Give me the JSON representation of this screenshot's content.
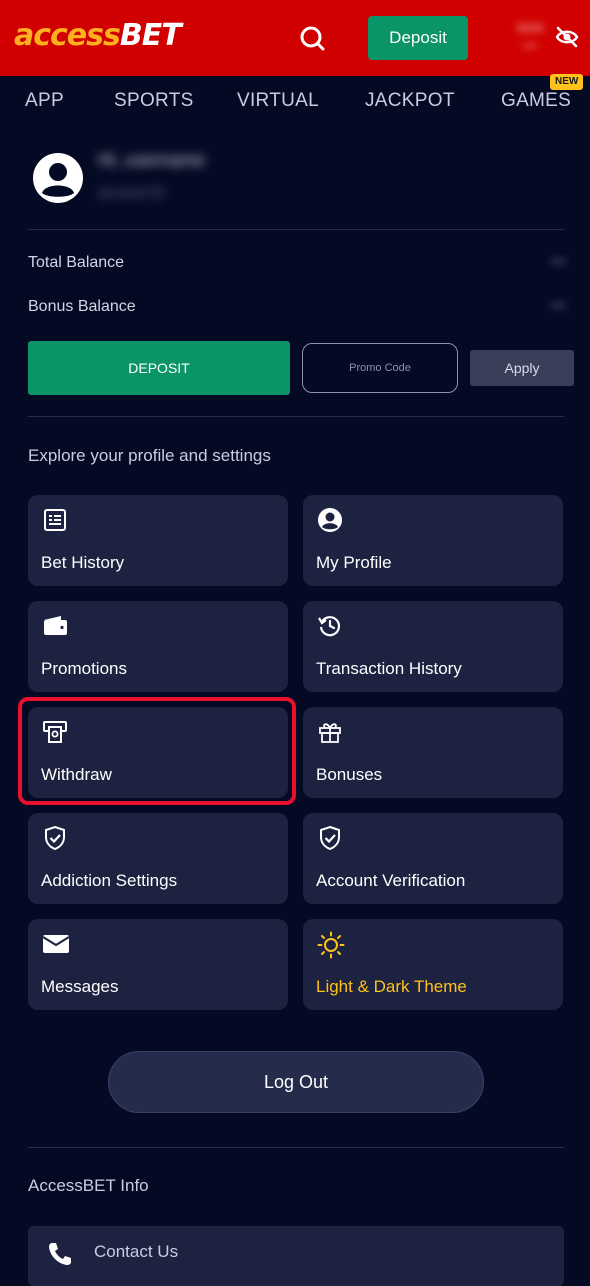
{
  "header": {
    "logo_part1": "access",
    "logo_part2": "BET",
    "deposit_label": "Deposit",
    "balance_line1": "NGN",
    "balance_line2": "***"
  },
  "nav": {
    "items": [
      "APP",
      "SPORTS",
      "VIRTUAL",
      "JACKPOT",
      "GAMES"
    ],
    "new_badge": "NEW"
  },
  "profile": {
    "greeting": "Hi, username",
    "account_line": "account ID"
  },
  "balances": {
    "total_label": "Total Balance",
    "total_value": "***",
    "bonus_label": "Bonus Balance",
    "bonus_value": "***"
  },
  "actions": {
    "deposit_label": "DEPOSIT",
    "promo_placeholder": "Promo Code",
    "apply_label": "Apply"
  },
  "settings": {
    "title": "Explore your profile and settings",
    "cards": [
      {
        "label": "Bet History",
        "icon": "receipt-icon"
      },
      {
        "label": "My Profile",
        "icon": "user-circle-icon"
      },
      {
        "label": "Promotions",
        "icon": "wallet-icon"
      },
      {
        "label": "Transaction History",
        "icon": "history-icon"
      },
      {
        "label": "Withdraw",
        "icon": "atm-withdraw-icon"
      },
      {
        "label": "Bonuses",
        "icon": "gift-icon"
      },
      {
        "label": "Addiction Settings",
        "icon": "shield-check-icon"
      },
      {
        "label": "Account Verification",
        "icon": "shield-check-icon"
      },
      {
        "label": "Messages",
        "icon": "envelope-icon"
      },
      {
        "label": "Light & Dark Theme",
        "icon": "sun-icon"
      }
    ]
  },
  "logout_label": "Log Out",
  "info": {
    "title": "AccessBET Info",
    "contact_label": "Contact Us"
  },
  "colors": {
    "header_red": "#d00000",
    "brand_green": "#0b9467",
    "accent_yellow": "#ffc21a",
    "background": "#050a24",
    "card": "#1c2240",
    "highlight_red": "#e8102c"
  }
}
